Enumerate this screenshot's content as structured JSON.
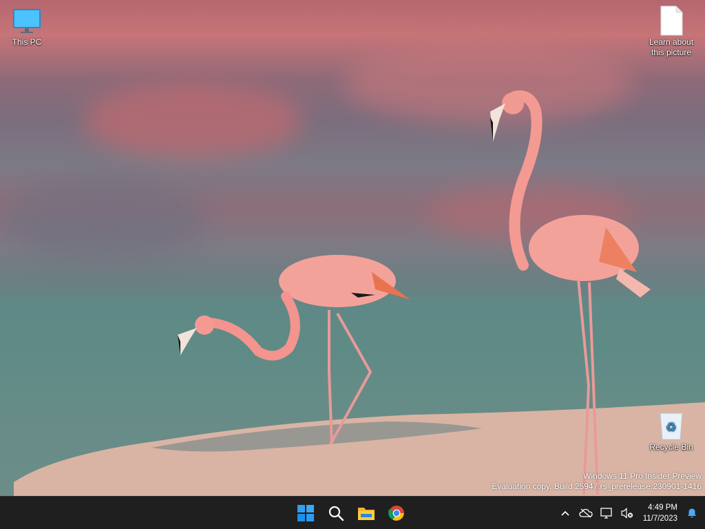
{
  "desktop": {
    "icons": [
      {
        "label": "This PC",
        "icon": "monitor-icon"
      },
      {
        "label": "Learn about this picture",
        "icon": "document-icon"
      },
      {
        "label": "Recycle Bin",
        "icon": "recycle-bin-icon"
      }
    ],
    "learn_line1": "Learn about",
    "learn_line2": "this picture"
  },
  "watermark": {
    "line1": "Windows 11 Pro Insider Preview",
    "line2": "Evaluation copy. Build 25947.rs_prerelease.230901-1416"
  },
  "taskbar": {
    "apps": [
      {
        "name": "Start",
        "icon": "windows-logo-icon"
      },
      {
        "name": "Search",
        "icon": "search-icon"
      },
      {
        "name": "File Explorer",
        "icon": "folder-icon"
      },
      {
        "name": "Google Chrome",
        "icon": "chrome-icon"
      }
    ],
    "tray": {
      "time": "4:49 PM",
      "date": "11/7/2023"
    },
    "colors": {
      "background": "#1f1f1f",
      "accent": "#0a84ff"
    }
  }
}
